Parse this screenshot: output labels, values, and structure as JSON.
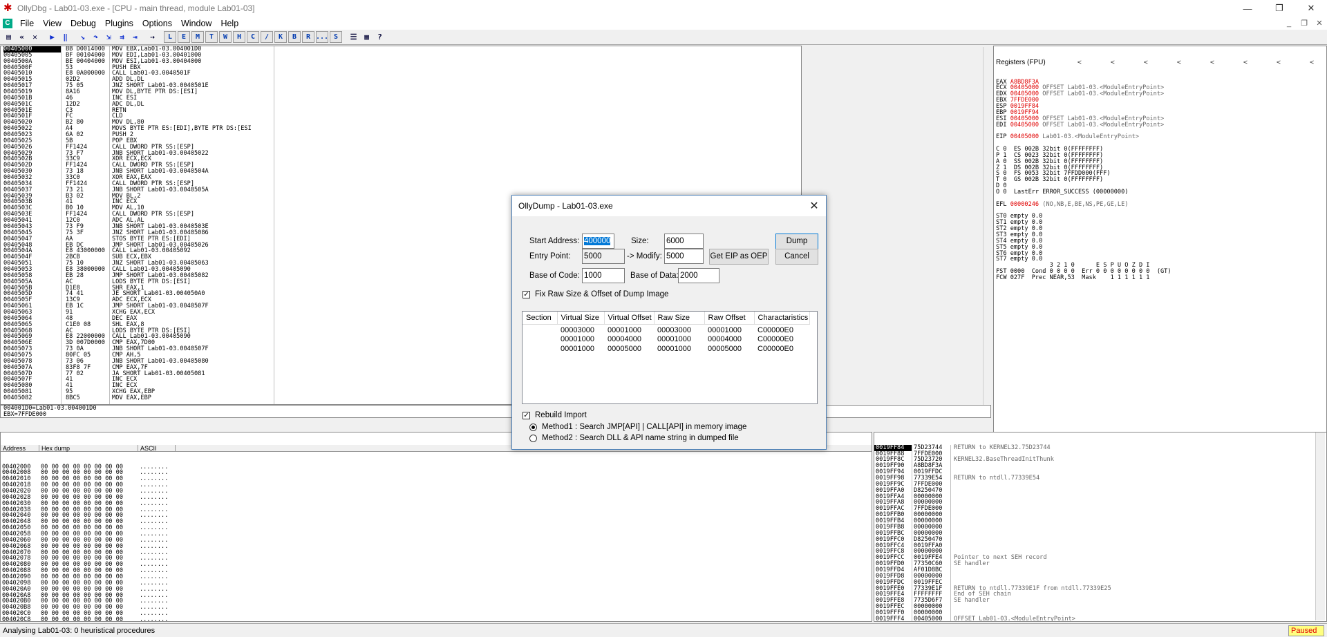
{
  "window": {
    "title": "OllyDbg - Lab01-03.exe - [CPU - main thread, module Lab01-03]",
    "min": "—",
    "max": "❐",
    "close": "✕"
  },
  "menu": [
    "File",
    "View",
    "Debug",
    "Plugins",
    "Options",
    "Window",
    "Help"
  ],
  "toolbar_letters": [
    "L",
    "E",
    "M",
    "T",
    "W",
    "H",
    "C",
    "/",
    "K",
    "B",
    "R",
    "...",
    "S"
  ],
  "disasm": {
    "addr": [
      "00405000",
      "00405005",
      "0040500A",
      "0040500F",
      "00405010",
      "00405015",
      "00405017",
      "00405019",
      "0040501B",
      "0040501C",
      "0040501E",
      "0040501F",
      "00405020",
      "00405022",
      "00405023",
      "00405025",
      "00405026",
      "00405029",
      "0040502B",
      "0040502D",
      "00405030",
      "00405032",
      "00405034",
      "00405037",
      "00405039",
      "0040503B",
      "0040503C",
      "0040503E",
      "00405041",
      "00405043",
      "00405045",
      "00405047",
      "00405048",
      "0040504A",
      "0040504F",
      "00405051",
      "00405053",
      "00405058",
      "0040505A",
      "0040505B",
      "0040505D",
      "0040505F",
      "00405061",
      "00405063",
      "00405064",
      "00405065",
      "00405068",
      "00405069",
      "0040506E",
      "00405073",
      "00405075",
      "00405078",
      "0040507A",
      "0040507D",
      "0040507F",
      "00405080",
      "00405081",
      "00405082"
    ],
    "hex": [
      "BB D0014000",
      "BF 00104000",
      "BE 00404000",
      "53",
      "E8 0A000000",
      "02D2",
      "75 05",
      "8A16",
      "46",
      "12D2",
      "C3",
      "FC",
      "B2 80",
      "A4",
      "6A 02",
      "5B",
      "FF1424",
      "73 F7",
      "33C9",
      "FF1424",
      "73 18",
      "33C0",
      "FF1424",
      "73 21",
      "B3 02",
      "41",
      "B0 10",
      "FF1424",
      "12C0",
      "73 F9",
      "75 3F",
      "AA",
      "EB DC",
      "E8 43000000",
      "2BCB",
      "75 10",
      "E8 38000000",
      "EB 28",
      "AC",
      "D1E8",
      "74 41",
      "13C9",
      "EB 1C",
      "91",
      "48",
      "C1E0 08",
      "AC",
      "E8 22000000",
      "3D 007D0000",
      "73 0A",
      "80FC 05",
      "73 06",
      "83F8 7F",
      "77 02",
      "41",
      "41",
      "95",
      "8BC5"
    ],
    "asm": [
      "MOV EBX,Lab01-03.004001D0",
      "MOV EDI,Lab01-03.00401000",
      "MOV ESI,Lab01-03.00404000",
      "PUSH EBX",
      "CALL Lab01-03.0040501F",
      "ADD DL,DL",
      "JNZ SHORT Lab01-03.0040501E",
      "MOV DL,BYTE PTR DS:[ESI]",
      "INC ESI",
      "ADC DL,DL",
      "RETN",
      "CLD",
      "MOV DL,80",
      "MOVS BYTE PTR ES:[EDI],BYTE PTR DS:[ESI",
      "PUSH 2",
      "POP EBX",
      "CALL DWORD PTR SS:[ESP]",
      "JNB SHORT Lab01-03.00405022",
      "XOR ECX,ECX",
      "CALL DWORD PTR SS:[ESP]",
      "JNB SHORT Lab01-03.0040504A",
      "XOR EAX,EAX",
      "CALL DWORD PTR SS:[ESP]",
      "JNB SHORT Lab01-03.0040505A",
      "MOV BL,2",
      "INC ECX",
      "MOV AL,10",
      "CALL DWORD PTR SS:[ESP]",
      "ADC AL,AL",
      "JNB SHORT Lab01-03.0040503E",
      "JNZ SHORT Lab01-03.00405086",
      "STOS BYTE PTR ES:[EDI]",
      "JMP SHORT Lab01-03.00405026",
      "CALL Lab01-03.00405092",
      "SUB ECX,EBX",
      "JNZ SHORT Lab01-03.00405063",
      "CALL Lab01-03.00405090",
      "JMP SHORT Lab01-03.00405082",
      "LODS BYTE PTR DS:[ESI]",
      "SHR EAX,1",
      "JE SHORT Lab01-03.004050A0",
      "ADC ECX,ECX",
      "JMP SHORT Lab01-03.0040507F",
      "XCHG EAX,ECX",
      "DEC EAX",
      "SHL EAX,8",
      "LODS BYTE PTR DS:[ESI]",
      "CALL Lab01-03.00405090",
      "CMP EAX,7D00",
      "JNB SHORT Lab01-03.0040507F",
      "CMP AH,5",
      "JNB SHORT Lab01-03.00405080",
      "CMP EAX,7F",
      "JA SHORT Lab01-03.00405081",
      "INC ECX",
      "INC ECX",
      "XCHG EAX,EBP",
      "MOV EAX,EBP"
    ],
    "info": "004001D0=Lab01-03.004001D0\nEBX=7FFDE000"
  },
  "registers": {
    "header": "Registers (FPU)",
    "nav": "< < < < < < < <",
    "lines": [
      [
        "EAX ",
        "A8BD8F3A",
        ""
      ],
      [
        "ECX ",
        "00405000",
        " OFFSET Lab01-03.<ModuleEntryPoint>"
      ],
      [
        "EDX ",
        "00405000",
        " OFFSET Lab01-03.<ModuleEntryPoint>"
      ],
      [
        "EBX ",
        "7FFDE000",
        ""
      ],
      [
        "ESP ",
        "0019FF84",
        ""
      ],
      [
        "EBP ",
        "0019FF94",
        ""
      ],
      [
        "ESI ",
        "00405000",
        " OFFSET Lab01-03.<ModuleEntryPoint>"
      ],
      [
        "EDI ",
        "00405000",
        " OFFSET Lab01-03.<ModuleEntryPoint>"
      ],
      [
        "",
        "",
        " "
      ],
      [
        "EIP ",
        "00405000",
        " Lab01-03.<ModuleEntryPoint>"
      ],
      [
        "",
        "",
        " "
      ],
      [
        "C 0  ES 002B 32bit 0(FFFFFFFF)",
        "",
        ""
      ],
      [
        "P 1  CS 0023 32bit 0(FFFFFFFF)",
        "",
        ""
      ],
      [
        "A 0  SS 002B 32bit 0(FFFFFFFF)",
        "",
        ""
      ],
      [
        "Z 1  DS 002B 32bit 0(FFFFFFFF)",
        "",
        ""
      ],
      [
        "S 0  FS 0053 32bit 7FFDD000(FFF)",
        "",
        ""
      ],
      [
        "T 0  GS 002B 32bit 0(FFFFFFFF)",
        "",
        ""
      ],
      [
        "D 0",
        "",
        ""
      ],
      [
        "O 0  LastErr ERROR_SUCCESS (00000000)",
        "",
        ""
      ],
      [
        "",
        "",
        " "
      ],
      [
        "EFL ",
        "00000246",
        " (NO,NB,E,BE,NS,PE,GE,LE)"
      ],
      [
        "",
        "",
        " "
      ],
      [
        "ST0 empty 0.0",
        "",
        ""
      ],
      [
        "ST1 empty 0.0",
        "",
        ""
      ],
      [
        "ST2 empty 0.0",
        "",
        ""
      ],
      [
        "ST3 empty 0.0",
        "",
        ""
      ],
      [
        "ST4 empty 0.0",
        "",
        ""
      ],
      [
        "ST5 empty 0.0",
        "",
        ""
      ],
      [
        "ST6 empty 0.0",
        "",
        ""
      ],
      [
        "ST7 empty 0.0",
        "",
        ""
      ],
      [
        "               3 2 1 0      E S P U O Z D I",
        "",
        ""
      ],
      [
        "FST 0000  Cond 0 0 0 0  Err 0 0 0 0 0 0 0 0  (GT)",
        "",
        ""
      ],
      [
        "FCW 027F  Prec NEAR,53  Mask    1 1 1 1 1 1",
        "",
        ""
      ]
    ]
  },
  "dump": {
    "headers": [
      "Address",
      "Hex dump",
      "ASCII"
    ],
    "addrs": [
      "00402000",
      "00402008",
      "00402010",
      "00402018",
      "00402020",
      "00402028",
      "00402030",
      "00402038",
      "00402040",
      "00402048",
      "00402050",
      "00402058",
      "00402060",
      "00402068",
      "00402070",
      "00402078",
      "00402080",
      "00402088",
      "00402090",
      "00402098",
      "004020A0",
      "004020A8",
      "004020B0",
      "004020B8",
      "004020C0",
      "004020C8",
      "004020D0",
      "004020D8",
      "004020E0"
    ],
    "hex": "00 00 00 00 00 00 00 00",
    "ascii": "........"
  },
  "stack": {
    "rows": [
      [
        "0019FF84",
        "75D23744",
        "RETURN to KERNEL32.75D23744"
      ],
      [
        "0019FF88",
        "7FFDE000",
        ""
      ],
      [
        "0019FF8C",
        "75D23720",
        "KERNEL32.BaseThreadInitThunk"
      ],
      [
        "0019FF90",
        "A8BD8F3A",
        ""
      ],
      [
        "0019FF94",
        "0019FFDC",
        ""
      ],
      [
        "0019FF98",
        "77339E54",
        "RETURN to ntdll.77339E54"
      ],
      [
        "0019FF9C",
        "7FFDE000",
        ""
      ],
      [
        "0019FFA0",
        "D8250470",
        ""
      ],
      [
        "0019FFA4",
        "00000000",
        ""
      ],
      [
        "0019FFA8",
        "00000000",
        ""
      ],
      [
        "0019FFAC",
        "7FFDE000",
        ""
      ],
      [
        "0019FFB0",
        "00000000",
        ""
      ],
      [
        "0019FFB4",
        "00000000",
        ""
      ],
      [
        "0019FFB8",
        "00000000",
        ""
      ],
      [
        "0019FFBC",
        "00000000",
        ""
      ],
      [
        "0019FFC0",
        "D8250470",
        ""
      ],
      [
        "0019FFC4",
        "0019FFA0",
        ""
      ],
      [
        "0019FFC8",
        "00000000",
        ""
      ],
      [
        "0019FFCC",
        "0019FFE4",
        "Pointer to next SEH record"
      ],
      [
        "0019FFD0",
        "77350C60",
        "SE handler"
      ],
      [
        "0019FFD4",
        "AF01D8BC",
        ""
      ],
      [
        "0019FFD8",
        "00000000",
        ""
      ],
      [
        "0019FFDC",
        "0019FFEC",
        ""
      ],
      [
        "0019FFE0",
        "77339E1F",
        "RETURN to ntdll.77339E1F from ntdll.77339E25"
      ],
      [
        "0019FFE4",
        "FFFFFFFF",
        "End of SEH chain"
      ],
      [
        "0019FFE8",
        "7735D6F7",
        "SE handler"
      ],
      [
        "0019FFEC",
        "00000000",
        ""
      ],
      [
        "0019FFF0",
        "00000000",
        ""
      ],
      [
        "0019FFF4",
        "00405000",
        "OFFSET Lab01-03.<ModuleEntryPoint>"
      ],
      [
        "0019FFF8",
        "7FFDE000",
        ""
      ],
      [
        "0019FFFC",
        "00000000",
        ""
      ]
    ]
  },
  "status": {
    "text": "Analysing Lab01-03: 0 heuristical procedures",
    "state": "Paused"
  },
  "dialog": {
    "title": "OllyDump - Lab01-03.exe",
    "start_address_label": "Start Address:",
    "start_address": "400000",
    "size_label": "Size:",
    "size": "6000",
    "entry_point_label": "Entry Point:",
    "entry_point": "5000",
    "modify_label": "-> Modify:",
    "modify": "5000",
    "base_code_label": "Base of Code:",
    "base_code": "1000",
    "base_data_label": "Base of Data:",
    "base_data": "2000",
    "dump_btn": "Dump",
    "cancel_btn": "Cancel",
    "geteip_btn": "Get EIP as OEP",
    "fix_raw_label": "Fix Raw Size & Offset of Dump Image",
    "columns": [
      "Section",
      "Virtual Size",
      "Virtual Offset",
      "Raw Size",
      "Raw Offset",
      "Charactaristics"
    ],
    "sections": [
      [
        "",
        "00003000",
        "00001000",
        "00003000",
        "00001000",
        "C00000E0"
      ],
      [
        "",
        "00001000",
        "00004000",
        "00001000",
        "00004000",
        "C00000E0"
      ],
      [
        "",
        "00001000",
        "00005000",
        "00001000",
        "00005000",
        "C00000E0"
      ]
    ],
    "rebuild_label": "Rebuild Import",
    "method1": "Method1 : Search JMP[API] | CALL[API] in memory image",
    "method2": "Method2 : Search DLL & API name string in dumped file"
  }
}
